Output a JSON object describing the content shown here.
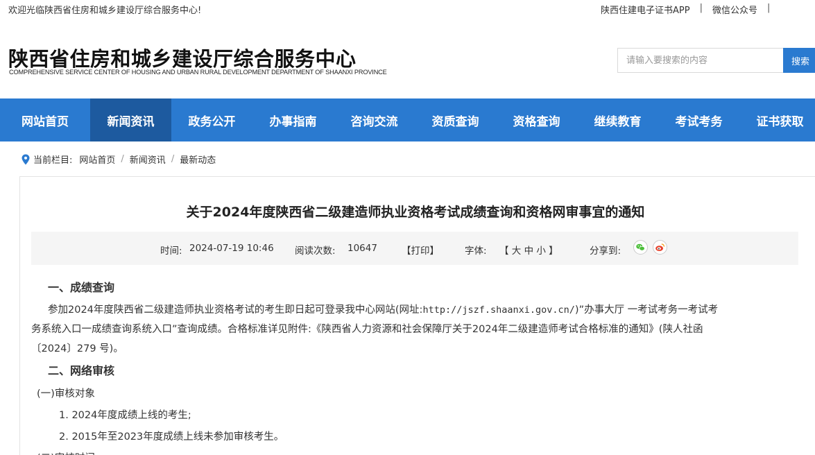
{
  "topbar": {
    "welcome": "欢迎光临陕西省住房和城乡建设厅综合服务中心!",
    "links": [
      "陕西住建电子证书APP",
      "微信公众号",
      ""
    ]
  },
  "header": {
    "logo_cn": "陕西省住房和城乡建设厅综合服务中心",
    "logo_en": "COMPREHENSIVE SERVICE CENTER OF HOUSING AND URBAN RURAL DEVELOPMENT DEPARTMENT OF SHAANXI PROVINCE",
    "search_placeholder": "请输入要搜索的内容",
    "search_button": "搜索"
  },
  "nav": {
    "items": [
      "网站首页",
      "新闻资讯",
      "政务公开",
      "办事指南",
      "咨询交流",
      "资质查询",
      "资格查询",
      "继续教育",
      "考试考务",
      "证书获取"
    ],
    "active_index": 1,
    "color": "#2a7ad0",
    "active_color": "#1d5a9f"
  },
  "breadcrumb": {
    "label": "当前栏目:",
    "items": [
      "网站首页",
      "新闻资讯",
      "最新动态"
    ]
  },
  "article": {
    "title": "关于2024年度陕西省二级建造师执业资格考试成绩查询和资格网审事宜的通知",
    "meta": {
      "time_label": "时间:",
      "time": "2024-07-19 10:46",
      "views_label": "阅读次数:",
      "views": "10647",
      "print": "【打印】",
      "font_label": "字体:",
      "font_sizes": "【 大 中 小 】",
      "share_label": "分享到:",
      "share_icons": [
        "wechat-icon",
        "weibo-icon"
      ]
    },
    "section1_heading": "一、成绩查询",
    "section1_p1_a": "参加2024年度陕西省二级建造师执业资格考试的考生即日起可登录我中心网站(网址:",
    "section1_url": "http://jszf.shaanxi.gov.cn/",
    "section1_p1_b": ")”办事大厅 一考试考务一考试考",
    "section1_p2": "务系统入口一成绩查询系统入口”查询成绩。合格标准详见附件:《陕西省人力资源和社会保障厅关于2024年二级建造师考试合格标准的通知》(陕人社函",
    "section1_p3": "〔2024〕279 号)。",
    "section2_heading": "二、网络审核",
    "sub1": "(一)审核对象",
    "list": [
      "1. 2024年度成绩上线的考生;",
      "2. 2015年至2023年度成绩上线未参加审核考生。"
    ],
    "sub2_partial": "(二)审核时间"
  }
}
